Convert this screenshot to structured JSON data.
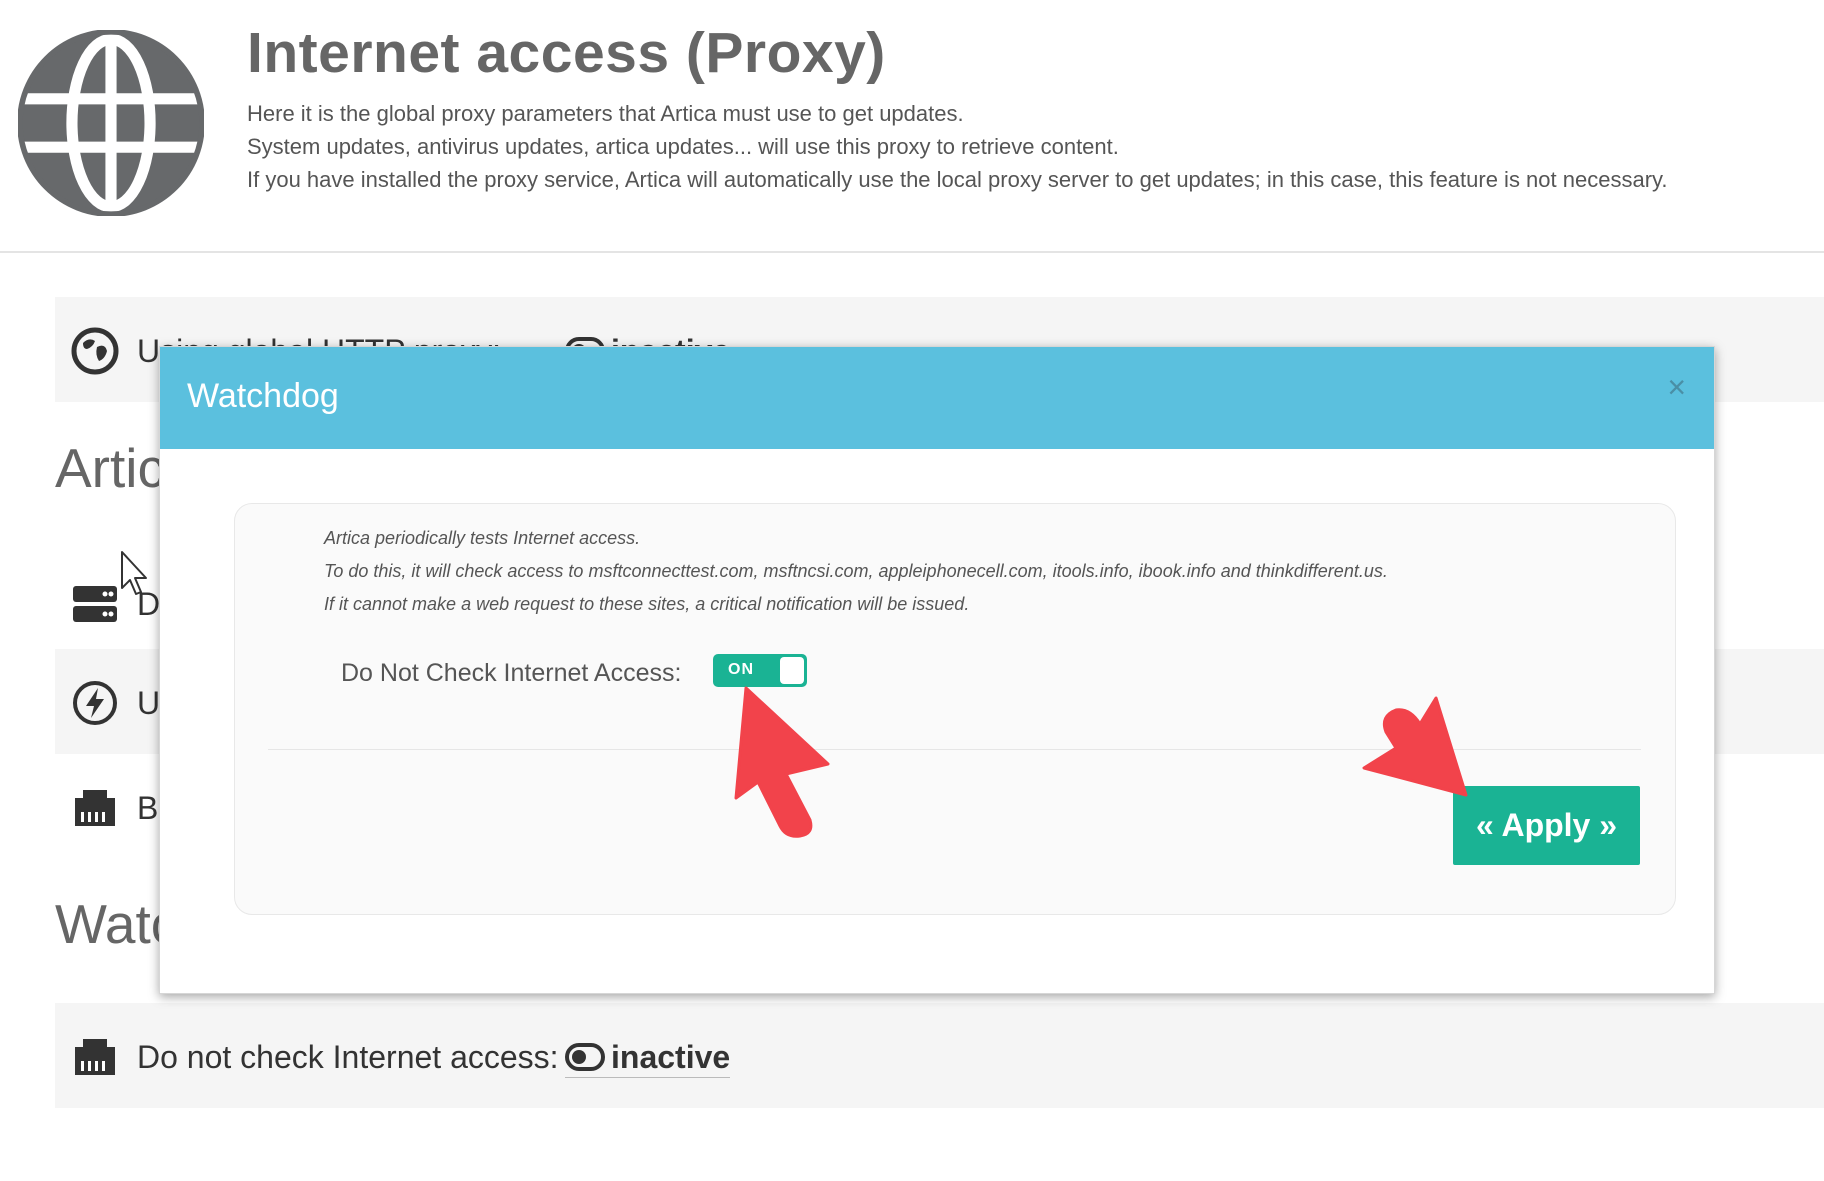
{
  "header": {
    "title": "Internet access (Proxy)",
    "lines": [
      "Here it is the global proxy parameters that Artica must use to get updates.",
      "System updates, antivirus updates, artica updates... will use this proxy to retrieve content.",
      "If you have installed the proxy service, Artica will automatically use the local proxy server to get updates; in this case, this feature is not necessary."
    ],
    "icon": "globe-icon"
  },
  "background": {
    "proxy_row_label": "Using global HTTP proxy:",
    "proxy_row_status": "inactive",
    "section_artica": "Artica",
    "row_d": "D",
    "row_u": "U",
    "row_b": "Bi",
    "section_watchdog": "Watchdog",
    "check_row_label": "Do not check Internet access:",
    "check_row_status": "inactive"
  },
  "modal": {
    "title": "Watchdog",
    "close": "×",
    "notes": [
      "Artica periodically tests Internet access.",
      "To do this, it will check access to msftconnecttest.com, msftncsi.com, appleiphonecell.com, itools.info, ibook.info and thinkdifferent.us.",
      "If it cannot make a web request to these sites, a critical notification will be issued."
    ],
    "field_label": "Do Not Check Internet Access:",
    "switch_state": "ON",
    "apply_label": "« Apply »"
  },
  "colors": {
    "modal_header": "#5bc0de",
    "primary_green": "#1ab394",
    "annotation_arrow": "#f2434b",
    "row_background": "#f5f5f5"
  }
}
